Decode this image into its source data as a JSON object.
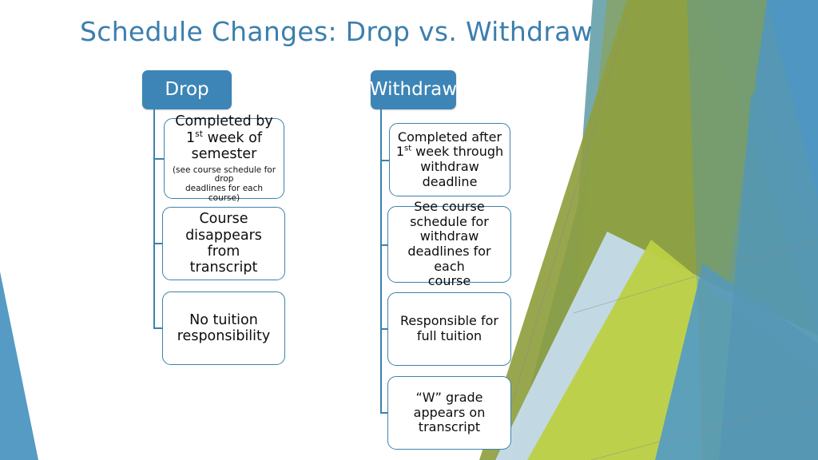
{
  "slide": {
    "title": "Schedule Changes:  Drop vs. Withdraw",
    "title_color": "#3b7fae",
    "background": "#ffffff"
  },
  "theme": {
    "accent_blue": "#3d85b6",
    "node_border": "#3b82ad",
    "olive": "#8fa03f",
    "teal": "#5d9aa5",
    "bright_green": "#bdd043",
    "light_blue": "#c5dced",
    "mid_blue": "#529ac6",
    "deep_blue": "#4f96c2"
  },
  "diagram": {
    "columns": [
      {
        "id": "drop",
        "header": "Drop",
        "nodes": [
          {
            "main": "Completed by\n1st week of\nsemester",
            "main_parts": [
              "Completed by",
              "1",
              "st",
              " week of",
              "semester"
            ],
            "sub": "(see course schedule for drop deadlines for each course)"
          },
          {
            "main": "Course\ndisappears from\ntranscript",
            "sub": ""
          },
          {
            "main": "No tuition\nresponsibility",
            "sub": ""
          }
        ]
      },
      {
        "id": "withdraw",
        "header": "Withdraw",
        "nodes": [
          {
            "main": "Completed after\n1st week through\nwithdraw\ndeadline",
            "main_parts": [
              "Completed after",
              "1",
              "st",
              " week through",
              "withdraw",
              "deadline"
            ],
            "sub": ""
          },
          {
            "main": "See course\nschedule for\nwithdraw\ndeadlines for each\ncourse",
            "sub": ""
          },
          {
            "main": "Responsible for\nfull tuition",
            "sub": ""
          },
          {
            "main": "“W” grade\nappears on\ntranscript",
            "sub": ""
          }
        ]
      }
    ]
  },
  "nodes_text": {
    "drop_1_line1": "Completed by",
    "drop_1_line2_pre": "1",
    "drop_1_line2_sup": "st",
    "drop_1_line2_post": " week of",
    "drop_1_line3": "semester",
    "drop_1_sub_line1": "(see course schedule for drop",
    "drop_1_sub_line2": "deadlines for each course)",
    "drop_2_line1": "Course",
    "drop_2_line2": "disappears from",
    "drop_2_line3": "transcript",
    "drop_3_line1": "No tuition",
    "drop_3_line2": "responsibility",
    "wd_1_line1": "Completed after",
    "wd_1_line2_pre": "1",
    "wd_1_line2_sup": "st",
    "wd_1_line2_post": " week through",
    "wd_1_line3": "withdraw",
    "wd_1_line4": "deadline",
    "wd_2_line1": "See course",
    "wd_2_line2": "schedule for",
    "wd_2_line3": "withdraw",
    "wd_2_line4": "deadlines for each",
    "wd_2_line5": "course",
    "wd_3_line1": "Responsible for",
    "wd_3_line2": "full tuition",
    "wd_4_line1": "“W” grade",
    "wd_4_line2": "appears on",
    "wd_4_line3": "transcript"
  }
}
